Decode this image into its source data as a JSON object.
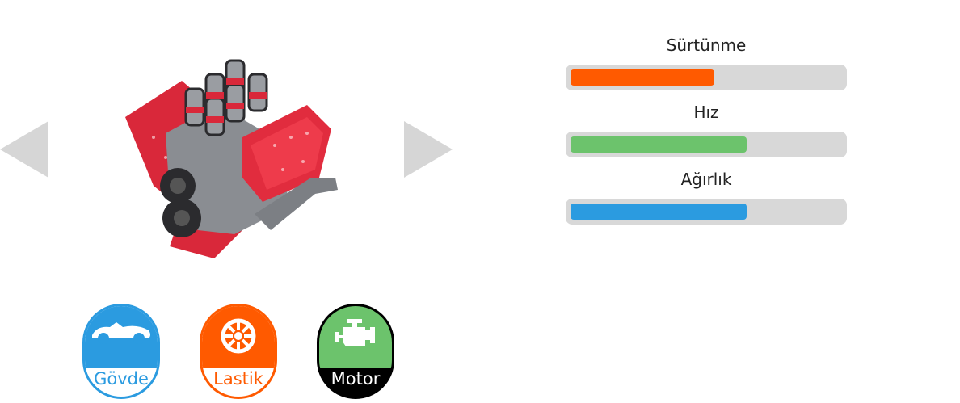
{
  "stats": [
    {
      "label": "Sürtünme",
      "value": 0.53,
      "color": "#ff5a00"
    },
    {
      "label": "Hız",
      "value": 0.65,
      "color": "#6cc36c"
    },
    {
      "label": "Ağırlık",
      "value": 0.65,
      "color": "#2b9be0"
    }
  ],
  "parts": {
    "body": {
      "label": "Gövde",
      "icon": "car-icon"
    },
    "tire": {
      "label": "Lastik",
      "icon": "wheel-icon"
    },
    "engine": {
      "label": "Motor",
      "icon": "engine-icon",
      "selected": true
    }
  },
  "nav": {
    "prev_icon": "triangle-left-icon",
    "next_icon": "triangle-right-icon"
  },
  "preview": {
    "icon": "v8-engine-image"
  }
}
